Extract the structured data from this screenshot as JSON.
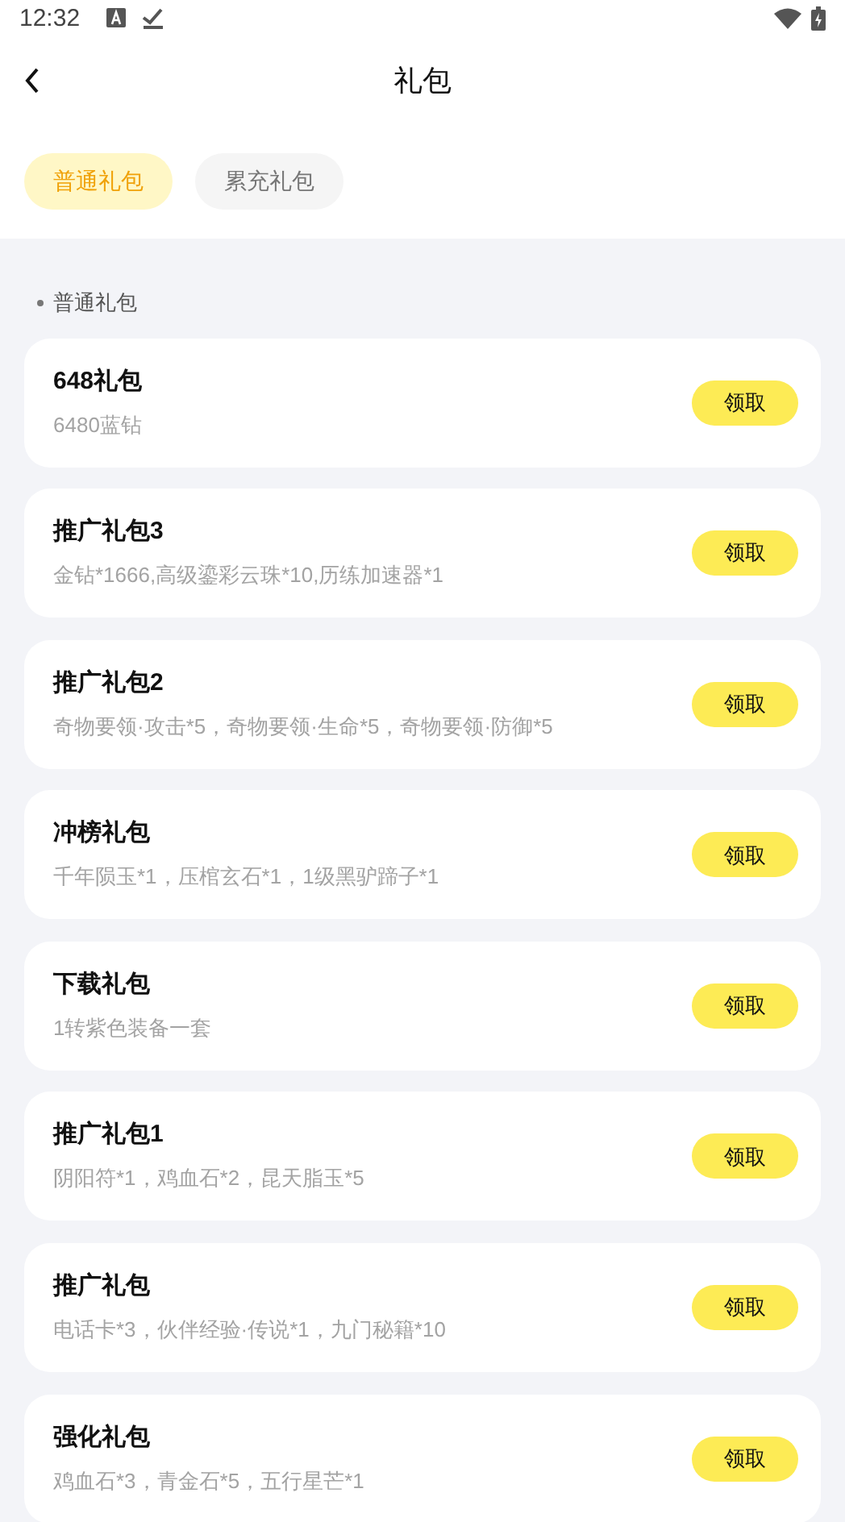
{
  "status_bar": {
    "time": "12:32"
  },
  "header": {
    "title": "礼包"
  },
  "tabs": [
    {
      "label": "普通礼包",
      "selected": true
    },
    {
      "label": "累充礼包",
      "selected": false
    }
  ],
  "section": {
    "title": "普通礼包"
  },
  "gifts": [
    {
      "name": "648礼包",
      "desc": "6480蓝钻",
      "button": "领取"
    },
    {
      "name": "推广礼包3",
      "desc": "金钻*1666,高级鎏彩云珠*10,历练加速器*1",
      "button": "领取"
    },
    {
      "name": "推广礼包2",
      "desc": "奇物要领·攻击*5，奇物要领·生命*5，奇物要领·防御*5",
      "button": "领取"
    },
    {
      "name": "冲榜礼包",
      "desc": "千年陨玉*1，压棺玄石*1，1级黑驴蹄子*1",
      "button": "领取"
    },
    {
      "name": "下载礼包",
      "desc": "1转紫色装备一套",
      "button": "领取"
    },
    {
      "name": "推广礼包1",
      "desc": "阴阳符*1，鸡血石*2，昆天脂玉*5",
      "button": "领取"
    },
    {
      "name": "推广礼包",
      "desc": "电话卡*3，伙伴经验·传说*1，九门秘籍*10",
      "button": "领取"
    },
    {
      "name": "强化礼包",
      "desc": "鸡血石*3，青金石*5，五行星芒*1",
      "button": "领取"
    }
  ]
}
